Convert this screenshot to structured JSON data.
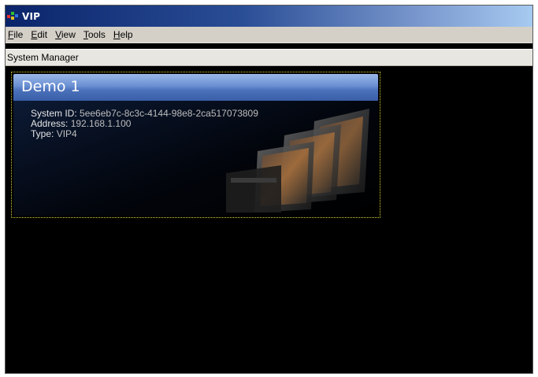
{
  "window": {
    "title": "VIP"
  },
  "menu": {
    "items": [
      {
        "pre": "",
        "u": "F",
        "post": "ile"
      },
      {
        "pre": "",
        "u": "E",
        "post": "dit"
      },
      {
        "pre": "",
        "u": "V",
        "post": "iew"
      },
      {
        "pre": "",
        "u": "T",
        "post": "ools"
      },
      {
        "pre": "",
        "u": "H",
        "post": "elp"
      }
    ]
  },
  "panel": {
    "title": "System Manager"
  },
  "system": {
    "name": "Demo 1",
    "id_label": "System ID:",
    "id_value": "5ee6eb7c-8c3c-4144-98e8-2ca517073809",
    "address_label": "Address:",
    "address_value": "192.168.1.100",
    "type_label": "Type:",
    "type_value": "VIP4"
  },
  "colors": {
    "titlebar": "#0a246a",
    "card_header": "#4c72bc",
    "selection_border": "#d8d23a",
    "background": "#000000"
  }
}
